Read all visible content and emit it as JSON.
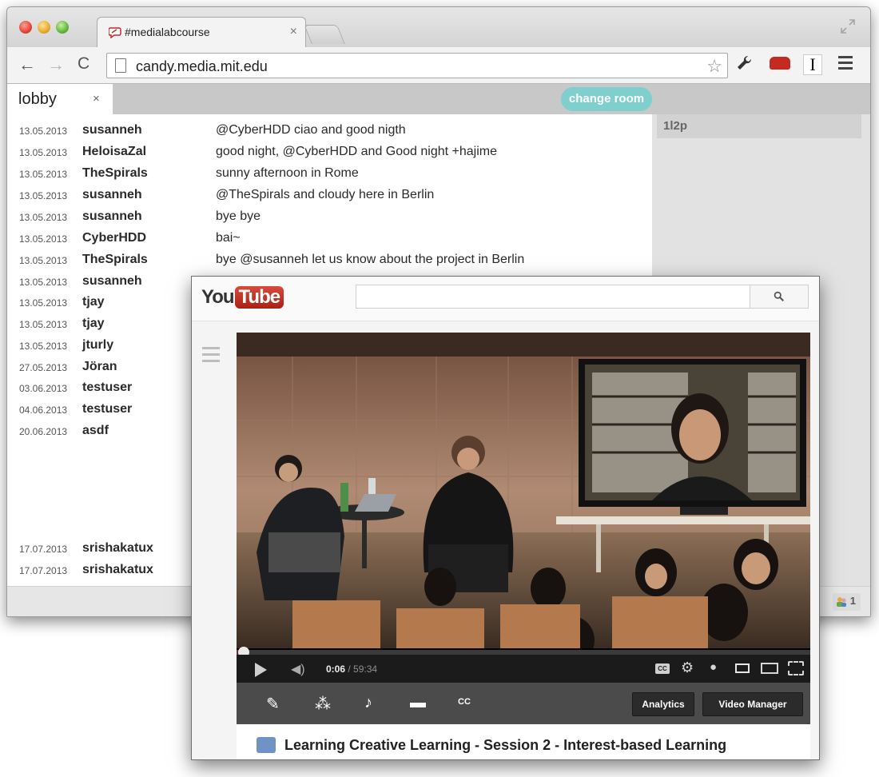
{
  "browser": {
    "tab_title": "#medialabcourse",
    "tab_close": "×",
    "url": "candy.media.mit.edu"
  },
  "chat": {
    "room_tab": "lobby",
    "room_close": "×",
    "change_room_label": "change room",
    "roster_items": [
      "1l2p"
    ],
    "accent": "#7fcfcf",
    "messages": [
      {
        "date": "13.05.2013",
        "user": "susanneh",
        "text": "@CyberHDD ciao and good nigth"
      },
      {
        "date": "13.05.2013",
        "user": "HeloisaZal",
        "text": "good night, @CyberHDD and Good night +hajime"
      },
      {
        "date": "13.05.2013",
        "user": "TheSpirals",
        "text": "sunny afternoon in Rome"
      },
      {
        "date": "13.05.2013",
        "user": "susanneh",
        "text": "@TheSpirals and cloudy here in Berlin"
      },
      {
        "date": "13.05.2013",
        "user": "susanneh",
        "text": "bye bye"
      },
      {
        "date": "13.05.2013",
        "user": "CyberHDD",
        "text": "bai~"
      },
      {
        "date": "13.05.2013",
        "user": "TheSpirals",
        "text": "bye @susanneh let us know about the project in Berlin"
      },
      {
        "date": "13.05.2013",
        "user": "susanneh",
        "text": ""
      },
      {
        "date": "13.05.2013",
        "user": "tjay",
        "text": ""
      },
      {
        "date": "13.05.2013",
        "user": "tjay",
        "text": ""
      },
      {
        "date": "13.05.2013",
        "user": "jturly",
        "text": ""
      },
      {
        "date": "27.05.2013",
        "user": "Jöran",
        "text": ""
      },
      {
        "date": "03.06.2013",
        "user": "testuser",
        "text": ""
      },
      {
        "date": "04.06.2013",
        "user": "testuser",
        "text": ""
      },
      {
        "date": "20.06.2013",
        "user": "asdf",
        "text": ""
      },
      {
        "date": "17.07.2013",
        "user": "srishakatux",
        "text": ""
      },
      {
        "date": "17.07.2013",
        "user": "srishakatux",
        "text": ""
      }
    ],
    "user_count": "1"
  },
  "youtube": {
    "logo_you": "You",
    "logo_tube": "Tube",
    "search_placeholder": "",
    "player": {
      "current_time": "0:06",
      "separator": " / ",
      "duration": "59:34",
      "progress_fraction": 0.0017,
      "cc_label": "CC"
    },
    "edit_bar": {
      "icons": [
        "pencil-icon",
        "magic-wand-icon",
        "music-note-icon",
        "annotation-icon",
        "captions-icon"
      ],
      "analytics_label": "Analytics",
      "video_manager_label": "Video Manager"
    },
    "video_title": "Learning Creative Learning - Session 2 - Interest-based Learning"
  }
}
